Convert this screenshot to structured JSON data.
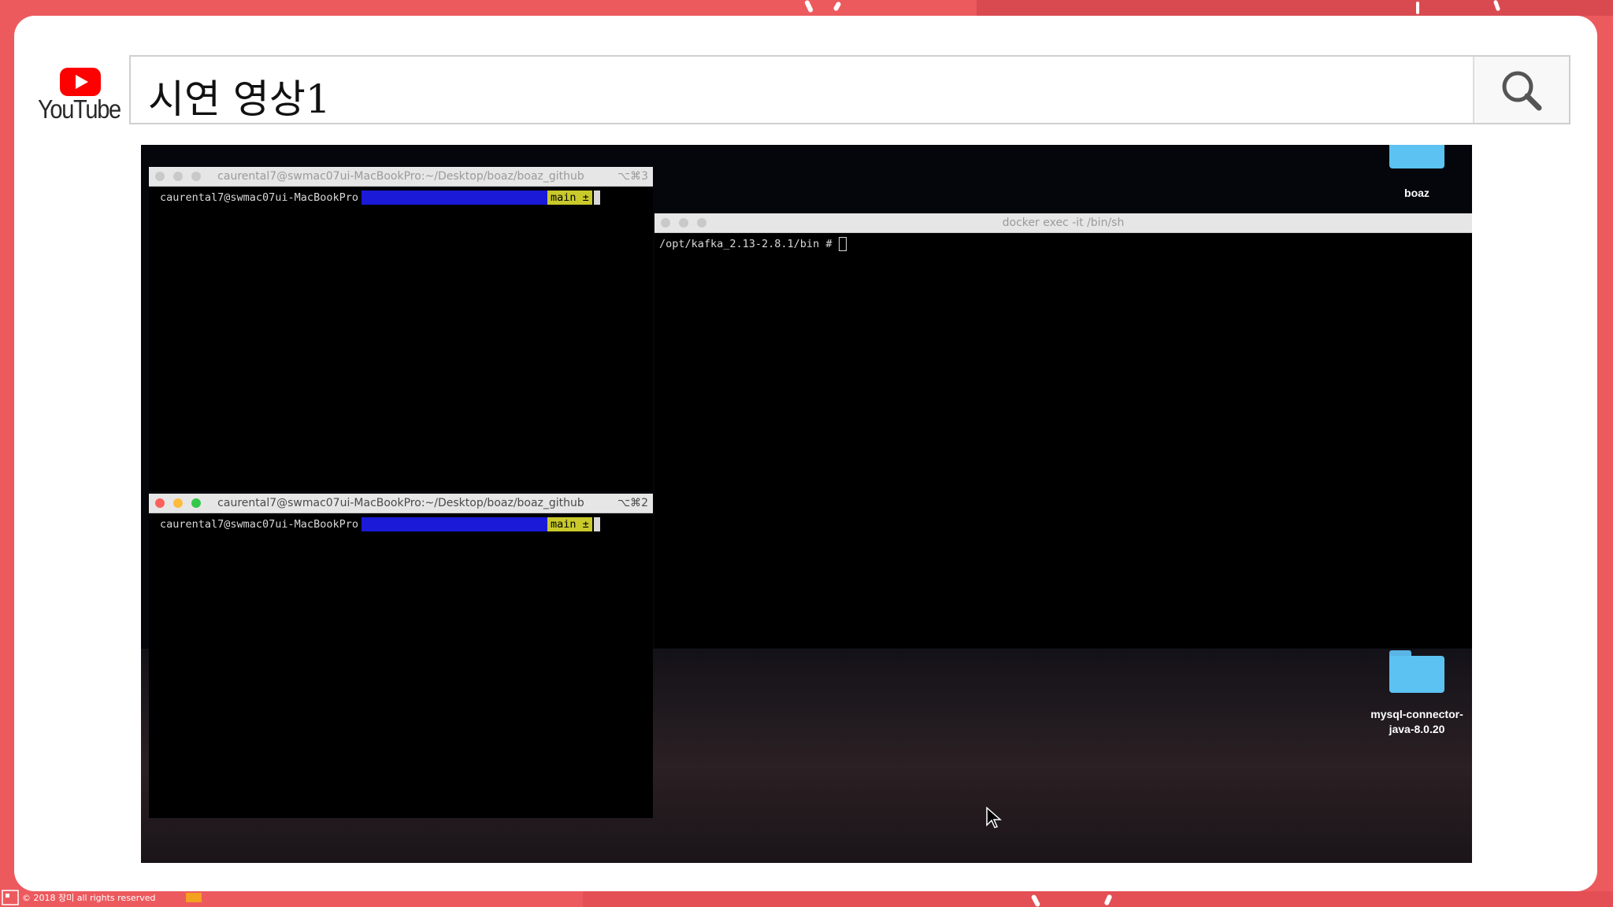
{
  "youtube": {
    "logo_text": "YouTube"
  },
  "search": {
    "query": "시연 영상1"
  },
  "terminals": [
    {
      "title": "caurental7@swmac07ui-MacBookPro:~/Desktop/boaz/boaz_github",
      "shortcut": "⌥⌘3",
      "prompt_user": "caurental7@swmac07ui-MacBookPro",
      "git_branch": "main ±"
    },
    {
      "title": "caurental7@swmac07ui-MacBookPro:~/Desktop/boaz/boaz_github",
      "shortcut": "⌥⌘2",
      "prompt_user": "caurental7@swmac07ui-MacBookPro",
      "git_branch": "main ±"
    },
    {
      "title": "docker exec -it  /bin/sh",
      "prompt": "/opt/kafka_2.13-2.8.1/bin #"
    }
  ],
  "desktop": {
    "folders": [
      {
        "label": "boaz"
      },
      {
        "label_line1": "mysql-connector-",
        "label_line2": "java-8.0.20"
      }
    ]
  },
  "footer": {
    "copyright": "© 2018 장미 all rights reserved"
  },
  "colors": {
    "background": "#ec5a5e",
    "youtube_red": "#ff0000",
    "folder_blue": "#5cc2f2",
    "prompt_blue": "#1a1ad8",
    "prompt_yellow": "#c9c92b"
  }
}
